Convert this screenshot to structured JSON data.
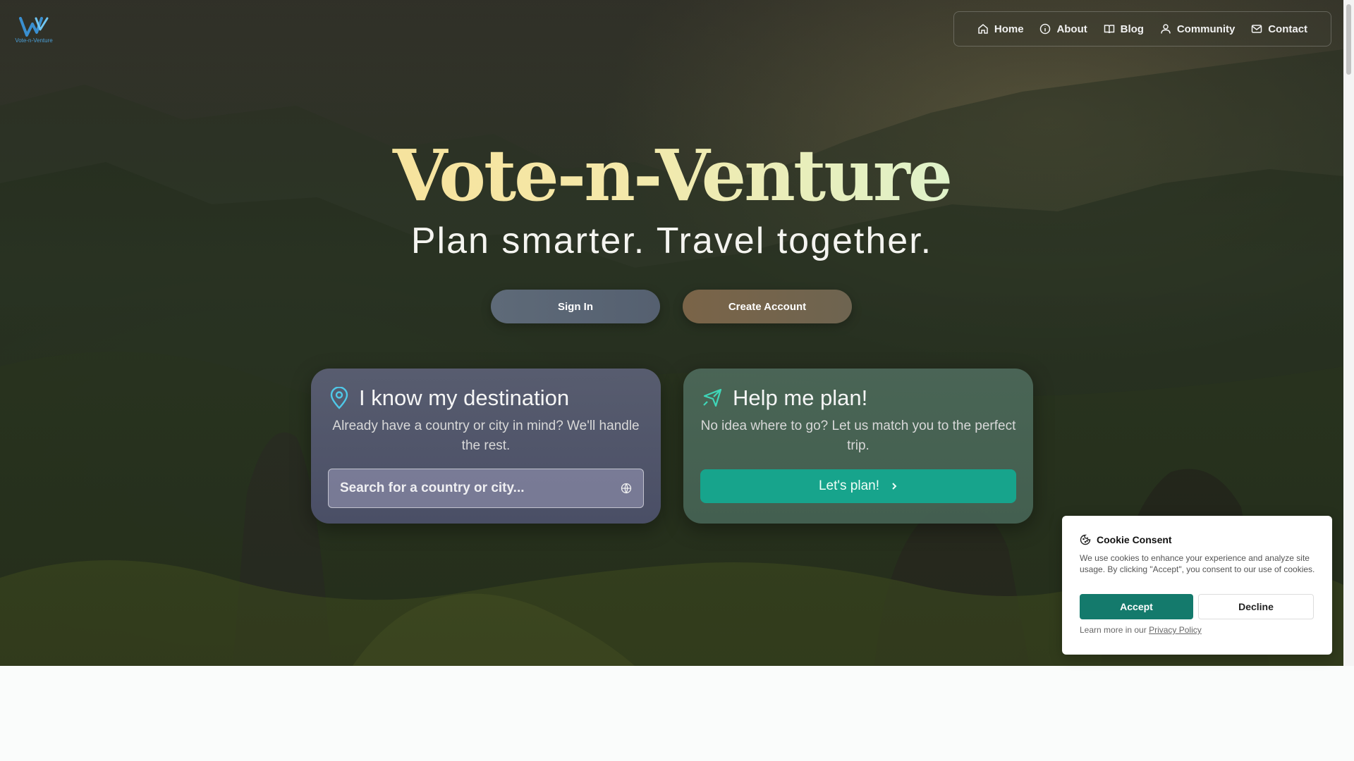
{
  "logo": {
    "text": "Vote-n-Venture",
    "icon": "w-logo-icon"
  },
  "nav": [
    {
      "label": "Home",
      "icon": "home-icon"
    },
    {
      "label": "About",
      "icon": "info-icon"
    },
    {
      "label": "Blog",
      "icon": "book-icon"
    },
    {
      "label": "Community",
      "icon": "user-icon"
    },
    {
      "label": "Contact",
      "icon": "mail-icon"
    }
  ],
  "hero": {
    "title": "Vote-n-Venture",
    "tagline": "Plan smarter. Travel together.",
    "signin_label": "Sign In",
    "create_label": "Create Account"
  },
  "destination_card": {
    "title": "I know my destination",
    "description": "Already have a country or city in mind? We'll handle the rest.",
    "search_placeholder": "Search for a country or city..."
  },
  "plan_card": {
    "title": "Help me plan!",
    "description": "No idea where to go? Let us match you to the perfect trip.",
    "button_label": "Let's plan!"
  },
  "cookie": {
    "title": "Cookie Consent",
    "text": "We use cookies to enhance your experience and analyze site usage. By clicking \"Accept\", you consent to our use of cookies.",
    "accept_label": "Accept",
    "decline_label": "Decline",
    "footer_prefix": "Learn more in our ",
    "footer_link": "Privacy Policy"
  },
  "colors": {
    "accent_teal": "#17a48c",
    "accept_green": "#147a6c",
    "title_gold": "#f7d98a",
    "title_mint": "#7ee0c8"
  }
}
